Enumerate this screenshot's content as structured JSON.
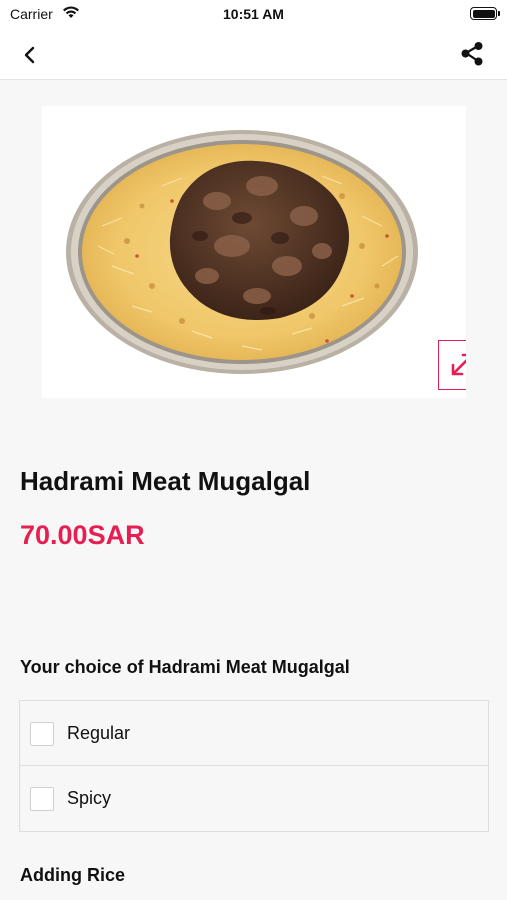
{
  "status_bar": {
    "carrier": "Carrier",
    "time": "10:51 AM",
    "battery_level": 1.0
  },
  "nav": {
    "back_icon": "chevron-left-icon",
    "share_icon": "share-icon"
  },
  "product": {
    "image_alt": "Hadrami Meat Mugalgal dish",
    "expand_icon": "expand-arrows-icon",
    "title": "Hadrami Meat Mugalgal",
    "price": "70.00SAR"
  },
  "choice_section": {
    "heading": "Your choice of Hadrami Meat Mugalgal",
    "options": [
      {
        "label": "Regular",
        "checked": false
      },
      {
        "label": "Spicy",
        "checked": false
      }
    ]
  },
  "rice_section": {
    "heading": "Adding Rice"
  },
  "colors": {
    "accent": "#e51f52",
    "background": "#f7f7f7"
  }
}
